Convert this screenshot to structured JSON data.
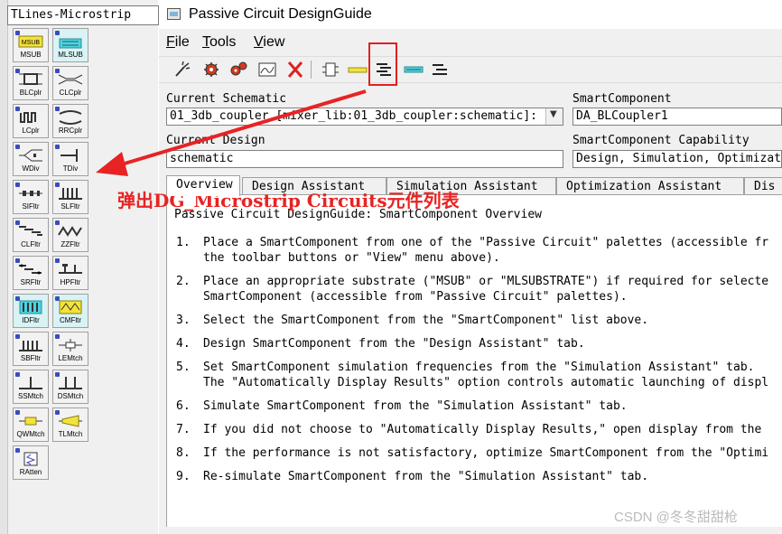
{
  "palette": {
    "library": "TLines-Microstrip",
    "items": [
      {
        "label": "MSUB",
        "icon": "msub-icon"
      },
      {
        "label": "MLSUB",
        "icon": "mlsub-icon"
      },
      {
        "label": "BLCplr",
        "icon": "branchline-coupler-icon"
      },
      {
        "label": "CLCplr",
        "icon": "coupled-line-coupler-icon"
      },
      {
        "label": "LCplr",
        "icon": "lange-coupler-icon"
      },
      {
        "label": "RRCplr",
        "icon": "rat-race-coupler-icon"
      },
      {
        "label": "WDiv",
        "icon": "wilkinson-divider-icon"
      },
      {
        "label": "TDiv",
        "icon": "tee-divider-icon"
      },
      {
        "label": "SIFltr",
        "icon": "stepped-impedance-filter-icon"
      },
      {
        "label": "SLFltr",
        "icon": "stub-filter-icon"
      },
      {
        "label": "CLFltr",
        "icon": "coupled-line-filter-icon"
      },
      {
        "label": "ZZFltr",
        "icon": "zigzag-filter-icon"
      },
      {
        "label": "SRFltr",
        "icon": "stepped-resonator-filter-icon"
      },
      {
        "label": "HPFltr",
        "icon": "highpass-filter-icon"
      },
      {
        "label": "IDFltr",
        "icon": "interdigital-filter-icon"
      },
      {
        "label": "CMFltr",
        "icon": "combline-filter-icon"
      },
      {
        "label": "SBFltr",
        "icon": "stopband-filter-icon"
      },
      {
        "label": "LEMtch",
        "icon": "lumped-element-match-icon"
      },
      {
        "label": "SSMtch",
        "icon": "single-stub-match-icon"
      },
      {
        "label": "DSMtch",
        "icon": "double-stub-match-icon"
      },
      {
        "label": "QWMtch",
        "icon": "quarter-wave-match-icon"
      },
      {
        "label": "TLMtch",
        "icon": "tapered-line-match-icon"
      },
      {
        "label": "RAtten",
        "icon": "resistive-attenuator-icon"
      }
    ]
  },
  "window": {
    "title": "Passive Circuit DesignGuide",
    "menu": [
      {
        "label": "File",
        "u": "F",
        "rest": "ile"
      },
      {
        "label": "Tools",
        "u": "T",
        "rest": "ools"
      },
      {
        "label": "View",
        "u": "V",
        "rest": "iew"
      }
    ],
    "toolbar": [
      "wand-icon",
      "gear-icon",
      "gears-icon",
      "display-icon",
      "delete-icon",
      "component-icon",
      "palette-icon",
      "list-components-icon",
      "list-icon-2",
      "list-icon-3"
    ]
  },
  "form": {
    "current_schematic_label": "Current Schematic",
    "current_schematic_value": "01_3db_coupler [mixer_lib:01_3db_coupler:schematic]:",
    "smart_component_label": "SmartComponent",
    "smart_component_value": "DA_BLCoupler1",
    "current_design_label": "Current Design",
    "current_design_value": "schematic",
    "capability_label": "SmartComponent Capability",
    "capability_value": "Design, Simulation, Optimization"
  },
  "tabs": [
    "Overview",
    "Design Assistant",
    "Simulation Assistant",
    "Optimization Assistant",
    "Dis"
  ],
  "overview": {
    "heading": "Passive Circuit DesignGuide: SmartComponent Overview",
    "steps": [
      {
        "n": "1.",
        "lines": [
          "Place a SmartComponent from one of the \"Passive Circuit\" palettes (accessible fr",
          "the toolbar buttons or \"View\" menu above)."
        ]
      },
      {
        "n": "2.",
        "lines": [
          "Place an appropriate substrate (\"MSUB\" or \"MLSUBSTRATE\") if required for selecte",
          "SmartComponent (accessible from \"Passive Circuit\" palettes)."
        ]
      },
      {
        "n": "3.",
        "lines": [
          "Select the SmartComponent from the \"SmartComponent\" list above."
        ]
      },
      {
        "n": "4.",
        "lines": [
          "Design SmartComponent from the \"Design Assistant\" tab."
        ]
      },
      {
        "n": "5.",
        "lines": [
          "Set SmartComponent simulation frequencies from the \"Simulation Assistant\" tab.",
          "The \"Automatically Display Results\" option controls automatic launching of displ"
        ]
      },
      {
        "n": "6.",
        "lines": [
          "Simulate SmartComponent from the \"Simulation Assistant\" tab."
        ]
      },
      {
        "n": "7.",
        "lines": [
          "If you did not choose to \"Automatically Display Results,\" open display from the"
        ]
      },
      {
        "n": "8.",
        "lines": [
          "If the performance is not satisfactory, optimize SmartComponent from the \"Optimi"
        ]
      },
      {
        "n": "9.",
        "lines": [
          "Re-simulate SmartComponent from the \"Simulation Assistant\" tab."
        ]
      }
    ]
  },
  "annotation": {
    "note": "弹出DG_Microstrip Circuits元件列表",
    "color": "#e82323"
  },
  "watermark": "CSDN @冬冬甜甜枪"
}
